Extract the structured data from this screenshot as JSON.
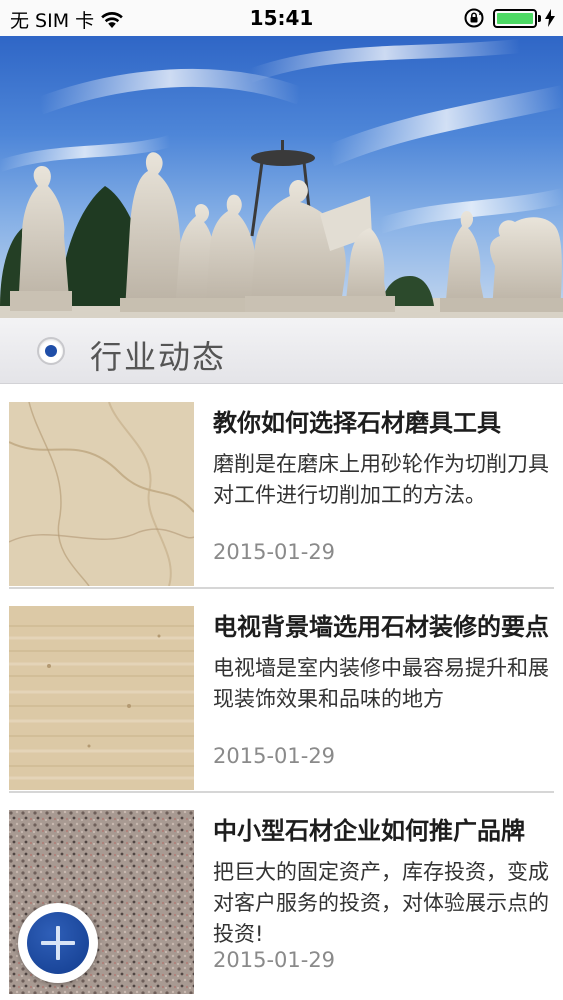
{
  "status_bar": {
    "carrier": "无 SIM 卡",
    "time": "15:41",
    "wifi_icon": "wifi-icon",
    "lock_icon": "rotation-lock-icon",
    "battery_icon": "battery-icon",
    "charging_icon": "charging-bolt-icon"
  },
  "banner": {
    "description_icon": "sculpture-banner-image"
  },
  "section": {
    "title": "行业动态",
    "icon": "radio-selected-icon"
  },
  "articles": [
    {
      "title": "教你如何选择石材磨具工具",
      "summary": "磨削是在磨床上用砂轮作为切削刀具对工件进行切削加工的方法。",
      "date": "2015-01-29",
      "thumb": "beige-marble-thumbnail"
    },
    {
      "title": "电视背景墙选用石材装修的要点",
      "summary": "电视墙是室内装修中最容易提升和展现装饰效果和品味的地方",
      "date": "2015-01-29",
      "thumb": "travertine-thumbnail"
    },
    {
      "title": "中小型石材企业如何推广品牌",
      "summary": "把巨大的固定资产，库存投资，变成对客户服务的投资，对体验展示点的投资!",
      "date": "2015-01-29",
      "thumb": "granite-thumbnail"
    }
  ],
  "fab": {
    "icon": "plus-icon"
  },
  "colors": {
    "accent": "#1f4ea8",
    "date_gray": "#8a8a8a",
    "battery_green": "#4cd964"
  }
}
